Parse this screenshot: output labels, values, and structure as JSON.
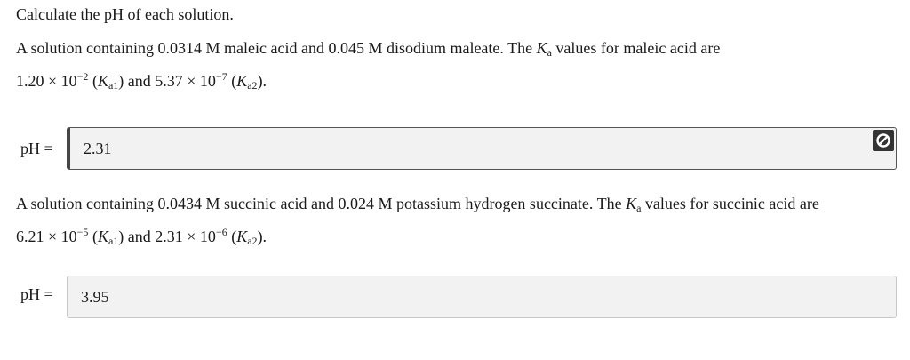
{
  "title": "Calculate the pH of each solution.",
  "q1": {
    "text_a": "A solution containing 0.0314 M maleic acid and 0.045 M disodium maleate. The ",
    "ka_sym": "K",
    "ka_sub": "a",
    "text_b": " values for maleic acid are",
    "v1": "1.20 × 10",
    "v1_exp": "−2",
    "k1_open": " (",
    "k1_sym": "K",
    "k1_sub": "a1",
    "k1_close": ")",
    "mid": " and ",
    "v2": "5.37 × 10",
    "v2_exp": "−7",
    "k2_open": " (",
    "k2_sym": "K",
    "k2_sub": "a2",
    "k2_close": ").",
    "ph_label": "pH =",
    "answer": "2.31",
    "status_icon": "no-entry-icon"
  },
  "q2": {
    "text_a": "A solution containing 0.0434 M succinic acid and 0.024 M potassium hydrogen succinate. The ",
    "ka_sym": "K",
    "ka_sub": "a",
    "text_b": " values for succinic acid are",
    "v1": "6.21 × 10",
    "v1_exp": "−5",
    "k1_open": " (",
    "k1_sym": "K",
    "k1_sub": "a1",
    "k1_close": ")",
    "mid": " and ",
    "v2": "2.31 × 10",
    "v2_exp": "−6",
    "k2_open": " (",
    "k2_sym": "K",
    "k2_sub": "a2",
    "k2_close": ").",
    "ph_label": "pH =",
    "answer": "3.95"
  },
  "colors": {
    "text": "#1a1a1a",
    "answer_bg": "#f2f2f2",
    "icon_bg": "#333333"
  }
}
